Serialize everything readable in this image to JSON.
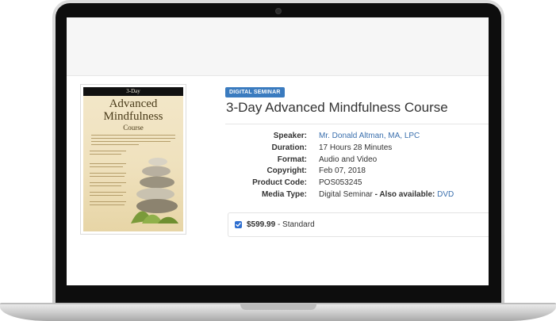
{
  "product": {
    "badge": "DIGITAL SEMINAR",
    "title": "3-Day Advanced Mindfulness Course",
    "cover": {
      "line1": "3-Day",
      "line2": "Advanced",
      "line3": "Mindfulness",
      "line4": "Course"
    },
    "specs": {
      "speaker_label": "Speaker:",
      "speaker_value": "Mr. Donald Altman, MA, LPC",
      "duration_label": "Duration:",
      "duration_value": "17 Hours 28 Minutes",
      "format_label": "Format:",
      "format_value": "Audio and Video",
      "copyright_label": "Copyright:",
      "copyright_value": "Feb 07, 2018",
      "code_label": "Product Code:",
      "code_value": "POS053245",
      "media_label": "Media Type:",
      "media_value": "Digital Seminar",
      "also_available_label": "- Also available:",
      "also_available_value": "DVD"
    },
    "price": {
      "amount": "$599.99",
      "tier": "- Standard",
      "checked": true
    }
  },
  "colors": {
    "badge": "#3a7bbf",
    "link": "#3a6fad",
    "checkbox": "#2f6fd0"
  }
}
